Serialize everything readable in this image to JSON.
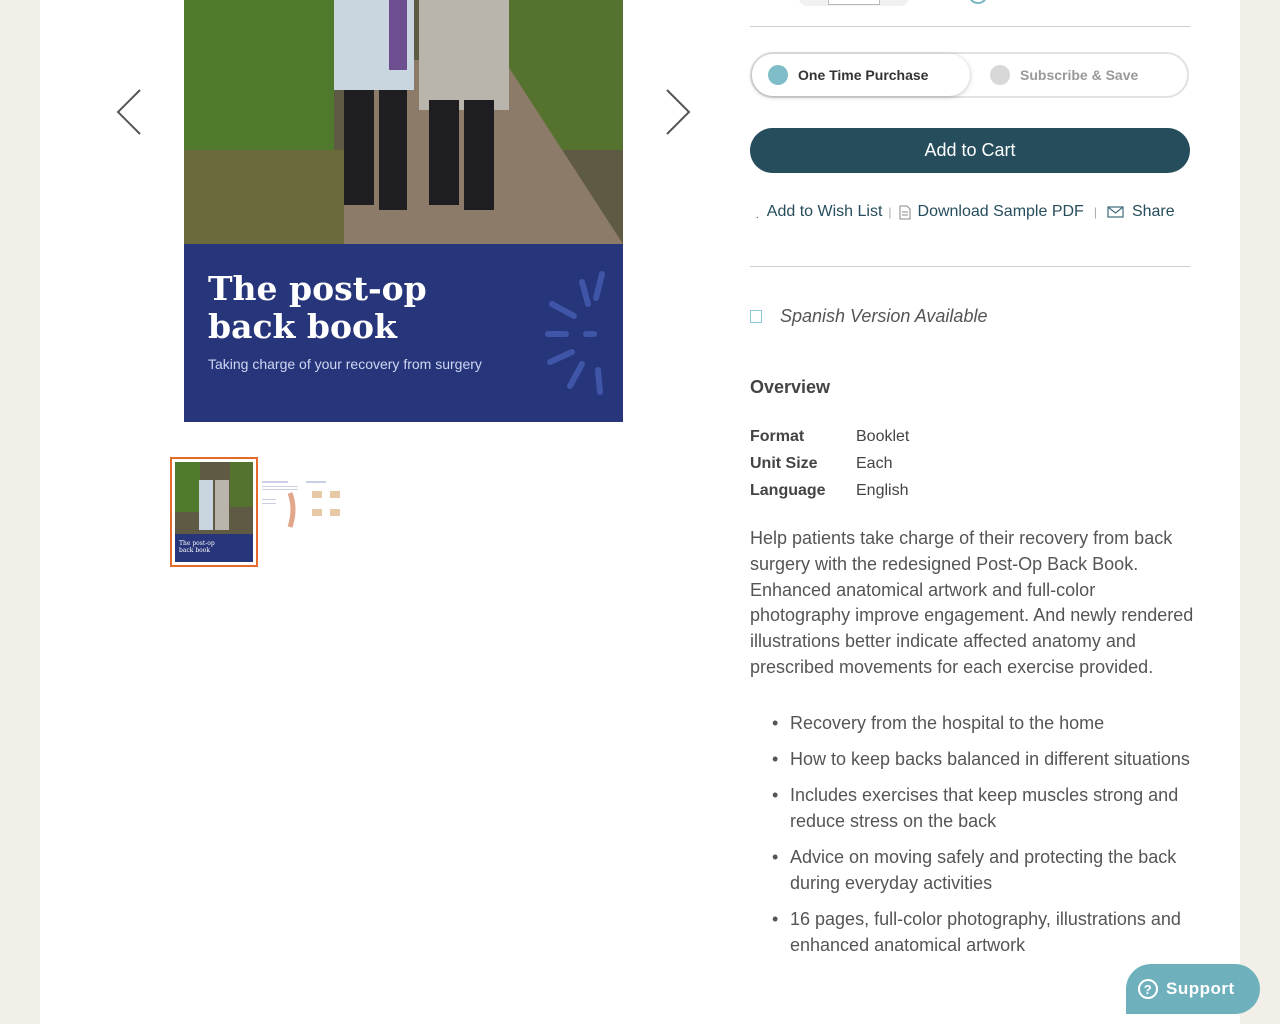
{
  "gallery": {
    "cover_title": "The post-op back book",
    "cover_subtitle": "Taking charge of your recovery from surgery",
    "thumb_title": "The post-op back book"
  },
  "purchase": {
    "one_time_label": "One Time Purchase",
    "subscribe_label": "Subscribe & Save",
    "add_to_cart_label": "Add to Cart"
  },
  "actions": {
    "wishlist_label": "Add to Wish List",
    "sample_pdf_label": "Download Sample PDF",
    "share_label": "Share",
    "separator": "|"
  },
  "spanish_label": "Spanish Version Available",
  "overview": {
    "heading": "Overview",
    "specs": [
      {
        "key": "Format",
        "value": "Booklet"
      },
      {
        "key": "Unit Size",
        "value": "Each"
      },
      {
        "key": "Language",
        "value": "English"
      }
    ],
    "description": "Help patients take charge of their recovery from back surgery with the redesigned Post-Op Back Book. Enhanced anatomical artwork and full-color photography improve engagement. And newly rendered illustrations better indicate affected anatomy and prescribed movements for each exercise provided.",
    "bullets": [
      "Recovery from the hospital to the home",
      "How to keep backs balanced in different situations",
      "Includes exercises that keep muscles strong and reduce stress on the back",
      "Advice on moving safely and protecting the back during everyday activities",
      "16 pages, full-color photography, illustrations and enhanced anatomical artwork"
    ]
  },
  "support_label": "Support",
  "colors": {
    "accent": "#264d5c",
    "radio_active": "#7fbec8",
    "cover_blue": "#27357a",
    "thumb_border": "#e36a2a",
    "support_bg": "#6fb0bd"
  },
  "icons": [
    "chevron-left-icon",
    "chevron-right-icon",
    "document-icon",
    "envelope-icon",
    "question-icon"
  ]
}
